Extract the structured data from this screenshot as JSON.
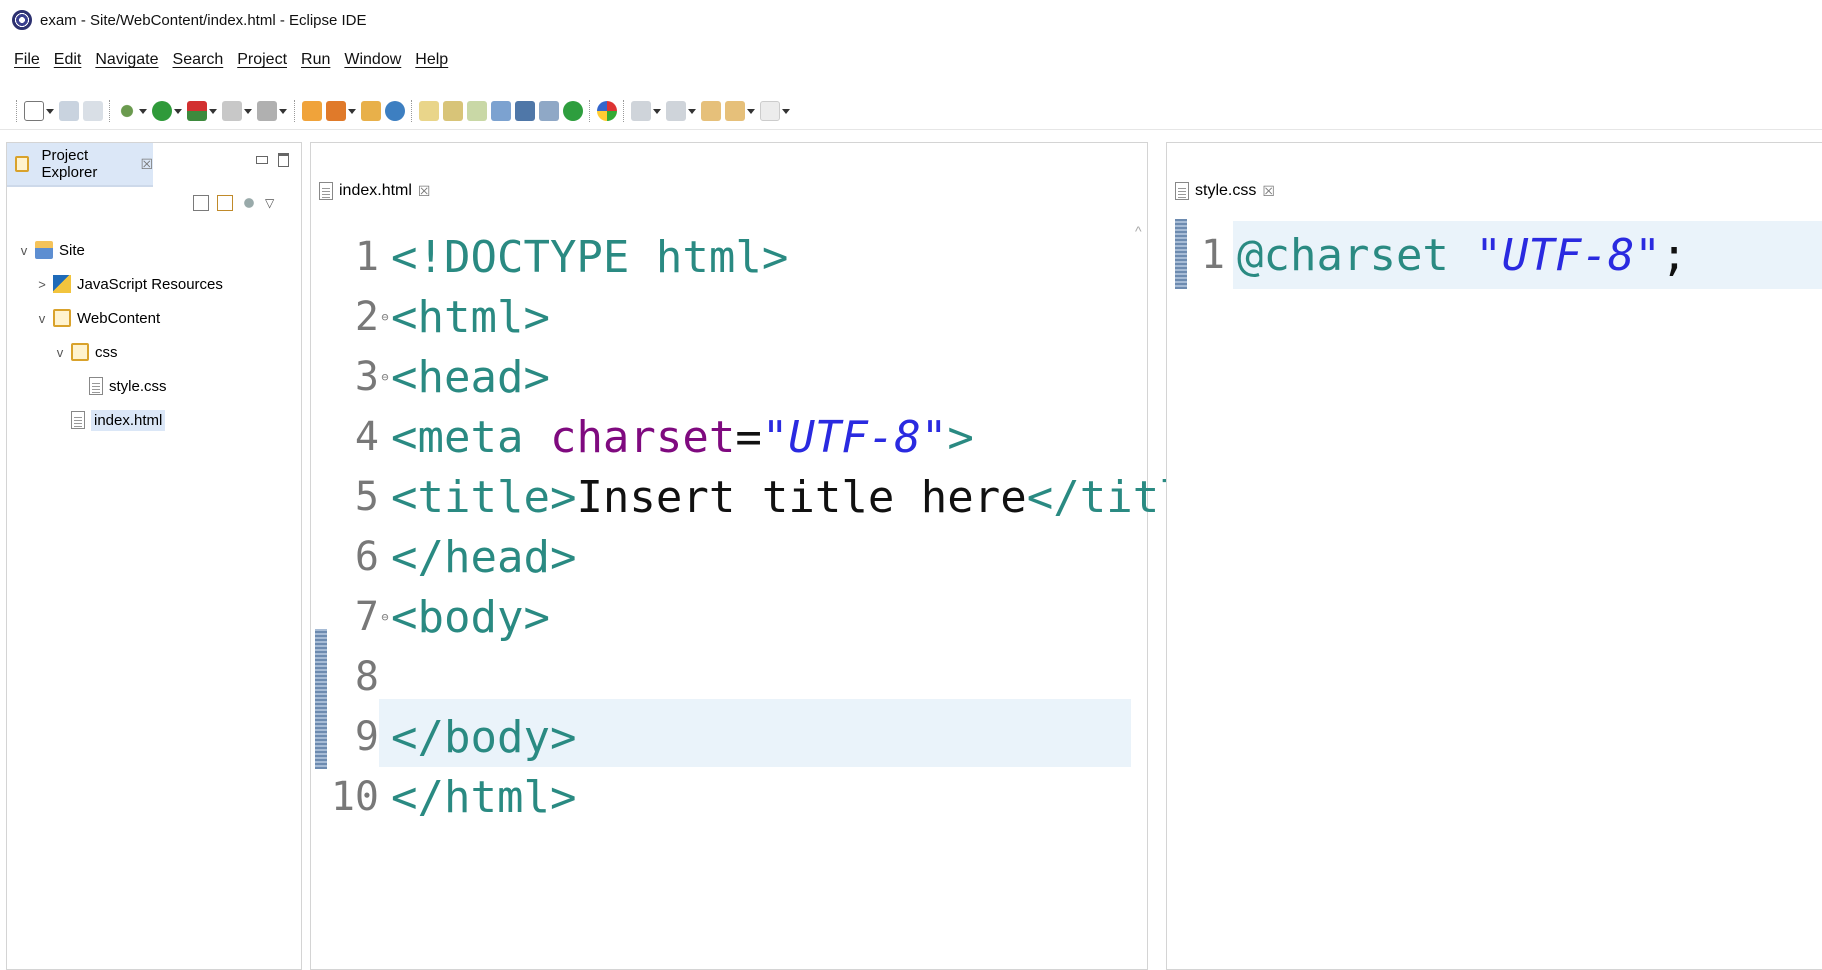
{
  "window": {
    "title": "exam - Site/WebContent/index.html - Eclipse IDE"
  },
  "menu": [
    "File",
    "Edit",
    "Navigate",
    "Search",
    "Project",
    "Run",
    "Window",
    "Help"
  ],
  "explorer": {
    "tab_label": "Project Explorer",
    "close_glyph": "☒",
    "tree": [
      {
        "label": "Site",
        "twisty": "v",
        "icon": "project-icon",
        "depth": 0
      },
      {
        "label": "JavaScript Resources",
        "twisty": ">",
        "icon": "js-resources-icon",
        "depth": 1
      },
      {
        "label": "WebContent",
        "twisty": "v",
        "icon": "folder-icon",
        "depth": 1
      },
      {
        "label": "css",
        "twisty": "v",
        "icon": "folder-icon",
        "depth": 2
      },
      {
        "label": "style.css",
        "twisty": "",
        "icon": "file-icon",
        "depth": 3
      },
      {
        "label": "index.html",
        "twisty": "",
        "icon": "file-icon",
        "depth": 2,
        "selected": true
      }
    ]
  },
  "editor_left": {
    "tab_label": "index.html",
    "close_glyph": "☒",
    "lines": [
      {
        "n": "1",
        "fold": "",
        "parts": [
          [
            "tag",
            "<!DOCTYPE html>"
          ]
        ]
      },
      {
        "n": "2",
        "fold": "⊖",
        "parts": [
          [
            "tag",
            "<html>"
          ]
        ]
      },
      {
        "n": "3",
        "fold": "⊖",
        "parts": [
          [
            "tag",
            "<head>"
          ]
        ]
      },
      {
        "n": "4",
        "fold": "",
        "parts": [
          [
            "tag",
            "<meta "
          ],
          [
            "attr",
            "charset"
          ],
          [
            "txt",
            "="
          ],
          [
            "str",
            "\"UTF-8\""
          ],
          [
            "tag",
            ">"
          ]
        ]
      },
      {
        "n": "5",
        "fold": "",
        "parts": [
          [
            "tag",
            "<title>"
          ],
          [
            "txt",
            "Insert title here"
          ],
          [
            "tag",
            "</title>"
          ]
        ]
      },
      {
        "n": "6",
        "fold": "",
        "parts": [
          [
            "tag",
            "</head>"
          ]
        ]
      },
      {
        "n": "7",
        "fold": "⊖",
        "parts": [
          [
            "tag",
            "<body>"
          ]
        ]
      },
      {
        "n": "8",
        "fold": "",
        "parts": []
      },
      {
        "n": "9",
        "fold": "",
        "parts": [
          [
            "tag",
            "</body>"
          ]
        ]
      },
      {
        "n": "10",
        "fold": "",
        "parts": [
          [
            "tag",
            "</html>"
          ]
        ]
      }
    ]
  },
  "editor_right": {
    "tab_label": "style.css",
    "close_glyph": "☒",
    "lines": [
      {
        "n": "1",
        "fold": "",
        "parts": [
          [
            "at",
            "@charset "
          ],
          [
            "str",
            "\"UTF-8\""
          ],
          [
            "txt",
            ";"
          ]
        ]
      }
    ]
  },
  "colors": {
    "tag": "#2a8a82",
    "attr": "#7f0a7f",
    "string": "#2a2ae0",
    "selection_tab": "#dbe7f7",
    "current_line": "#eaf3fa"
  }
}
